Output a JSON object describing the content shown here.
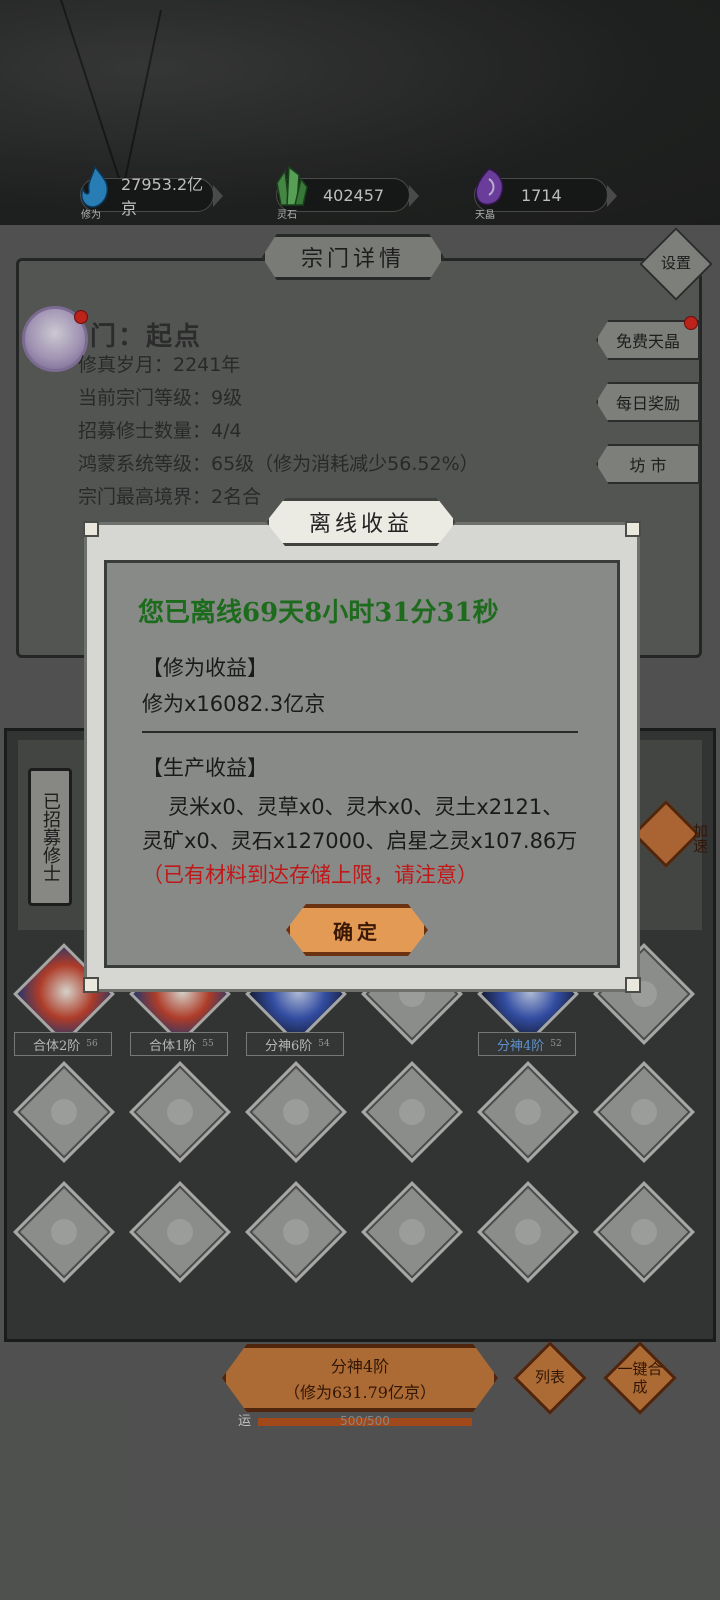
{
  "resources": [
    {
      "label": "修为",
      "value": "27953.2亿京",
      "icon": "blue-flame-icon",
      "color": "#3fa7d9"
    },
    {
      "label": "灵石",
      "value": "402457",
      "icon": "green-crystal-icon",
      "color": "#4a9a50"
    },
    {
      "label": "天晶",
      "value": "1714",
      "icon": "purple-gem-icon",
      "color": "#8a4fc0"
    }
  ],
  "sect": {
    "panel_title": "宗门详情",
    "settings_label": "设置",
    "name": "门：起点",
    "lines": [
      "修真岁月：2241年",
      "当前宗门等级：9级",
      "招募修士数量：4/4",
      "鸿蒙系统等级：65级（修为消耗减少56.52%）",
      "宗门最高境界：2名合"
    ],
    "side_buttons": [
      "免费天晶",
      "每日奖励",
      "坊 市"
    ]
  },
  "lower": {
    "recruited_label": "已招募修士",
    "speed_label": "加速",
    "heroes": [
      {
        "name": "合体2阶",
        "level": "56"
      },
      {
        "name": "合体1阶",
        "level": "55"
      },
      {
        "name": "分神6阶",
        "level": "54"
      },
      {
        "name": "分神4阶",
        "level": "52"
      }
    ]
  },
  "bottom": {
    "main_line1": "分神4阶",
    "main_line2": "（修为631.79亿京）",
    "list_label": "列表",
    "merge_label": "一键合成",
    "luck_label": "运",
    "progress_text": "500/500",
    "progress_fraction": 1.0
  },
  "dialog": {
    "title": "离线收益",
    "offline_time": "您已离线69天8小时31分31秒",
    "cultivation_header": "【修为收益】",
    "cultivation_value": "修为x16082.3亿京",
    "production_header": "【生产收益】",
    "production_text": "灵米x0、灵草x0、灵木x0、灵土x2121、灵矿x0、灵石x127000、启星之灵x107.86万",
    "production_warning": "（已有材料到达存储上限，请注意）",
    "confirm_label": "确定"
  },
  "colors": {
    "warning": "#c01818",
    "offline_time": "#1d6b1d",
    "accent_orange": "#c47a3d"
  }
}
